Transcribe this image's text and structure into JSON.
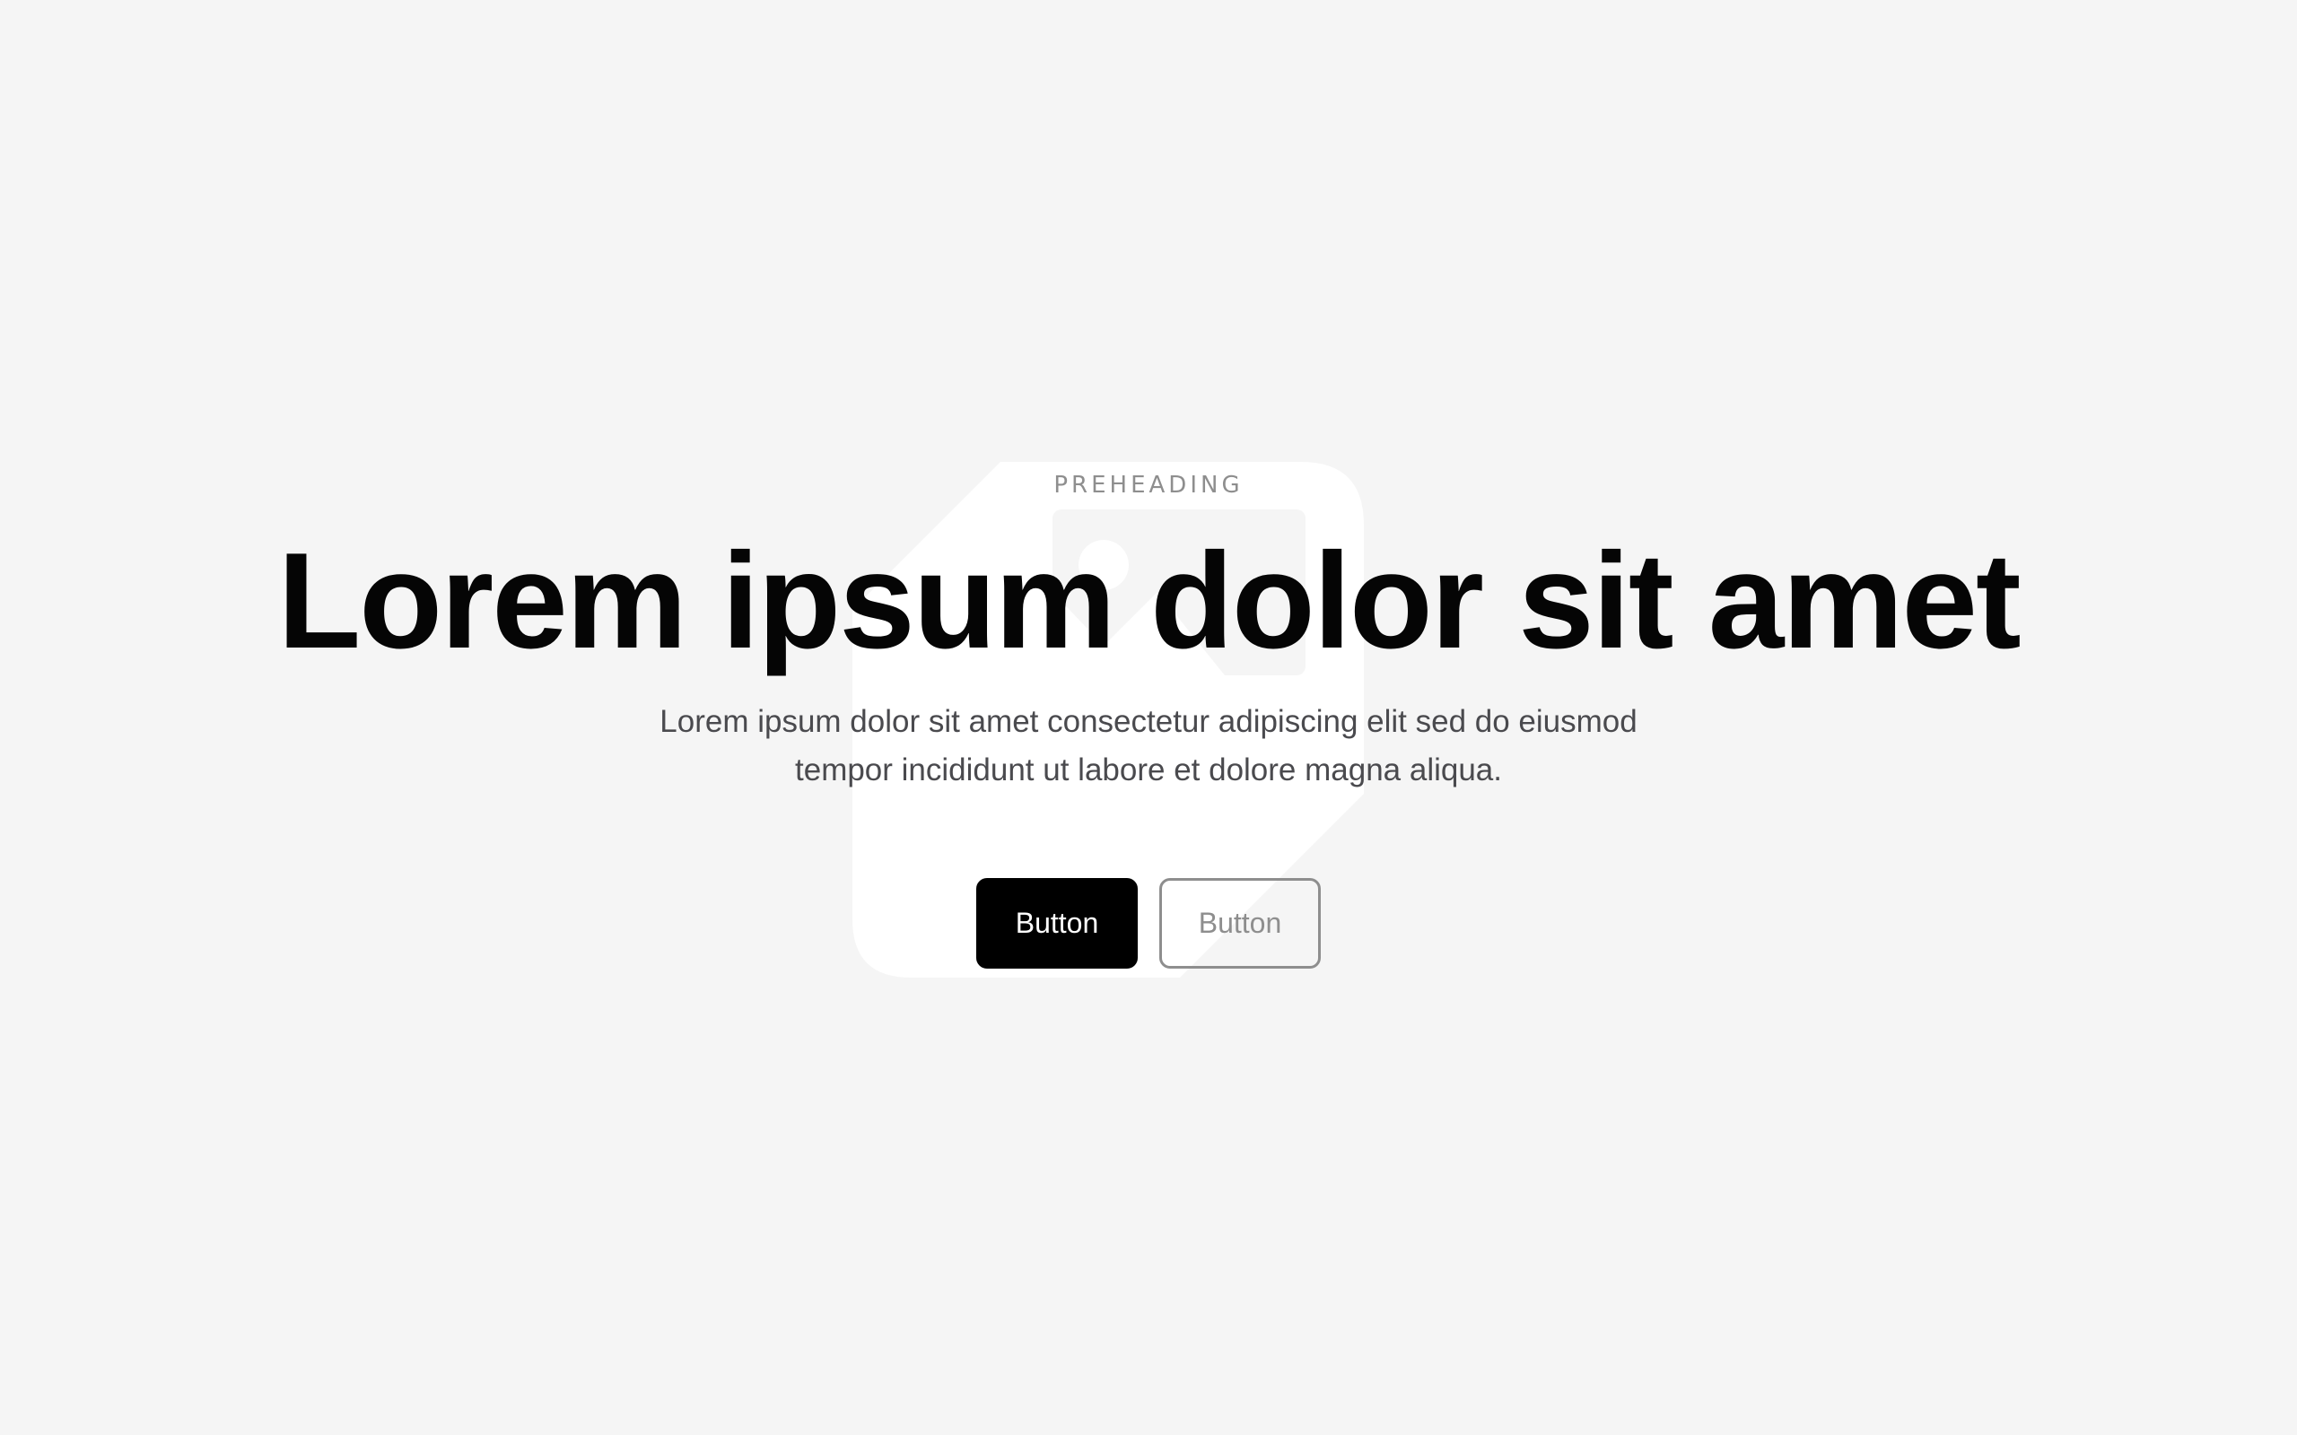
{
  "hero": {
    "preheading": "PREHEADING",
    "headline": "Lorem ipsum dolor sit amet",
    "subtext": "Lorem ipsum dolor sit amet consectetur adipiscing elit sed do eiusmod tempor incididunt ut labore et dolore magna aliqua.",
    "primary_button": "Button",
    "secondary_button": "Button"
  },
  "colors": {
    "background": "#f5f5f5",
    "placeholder": "#ffffff",
    "headline": "#050505",
    "body_text": "#4a4a4e",
    "muted": "#8e8e8e",
    "primary_button_bg": "#000000",
    "primary_button_text": "#ffffff"
  },
  "icons": {
    "background_illustration": "image-placeholder-icon"
  }
}
